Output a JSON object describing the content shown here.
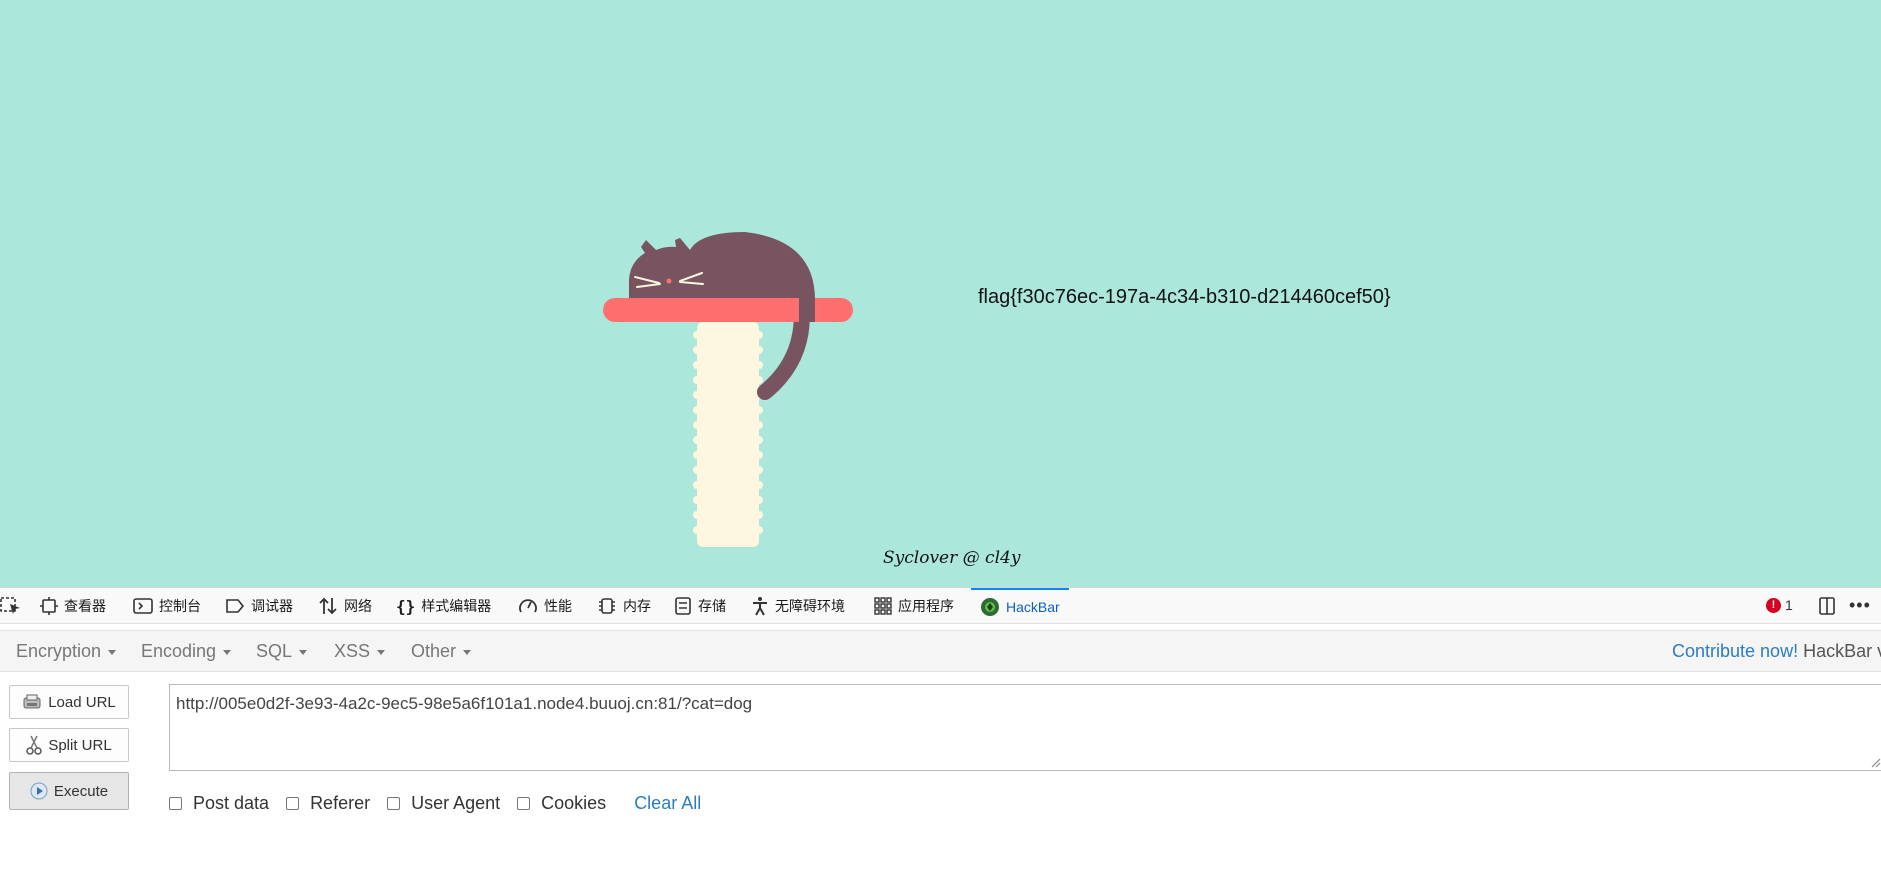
{
  "page": {
    "flag_text": "flag{f30c76ec-197a-4c34-b310-d214460cef50}",
    "credit": "Syclover @ cl4y",
    "background_color": "#abe7db"
  },
  "devtools": {
    "tabs": [
      {
        "label": "查看器",
        "icon": "inspector-icon"
      },
      {
        "label": "控制台",
        "icon": "console-icon"
      },
      {
        "label": "调试器",
        "icon": "debugger-icon"
      },
      {
        "label": "网络",
        "icon": "network-icon"
      },
      {
        "label": "样式编辑器",
        "icon": "style-editor-icon"
      },
      {
        "label": "性能",
        "icon": "performance-icon"
      },
      {
        "label": "内存",
        "icon": "memory-icon"
      },
      {
        "label": "存储",
        "icon": "storage-icon"
      },
      {
        "label": "无障碍环境",
        "icon": "accessibility-icon"
      },
      {
        "label": "应用程序",
        "icon": "application-icon"
      },
      {
        "label": "HackBar",
        "icon": "hackbar-icon",
        "active": true
      }
    ],
    "error_count": "1",
    "accent_color": "#0a84ff"
  },
  "hackbar": {
    "menus": [
      "Encryption",
      "Encoding",
      "SQL",
      "XSS",
      "Other"
    ],
    "contribute_label": "Contribute now!",
    "version_label": "HackBar v",
    "buttons": {
      "load_url": "Load URL",
      "split_url": "Split URL",
      "execute": "Execute"
    },
    "url_value": "http://005e0d2f-3e93-4a2c-9ec5-98e5a6f101a1.node4.buuoj.cn:81/?cat=dog",
    "options": [
      {
        "label": "Post data",
        "checked": false
      },
      {
        "label": "Referer",
        "checked": false
      },
      {
        "label": "User Agent",
        "checked": false
      },
      {
        "label": "Cookies",
        "checked": false
      }
    ],
    "clear_all_label": "Clear All"
  }
}
